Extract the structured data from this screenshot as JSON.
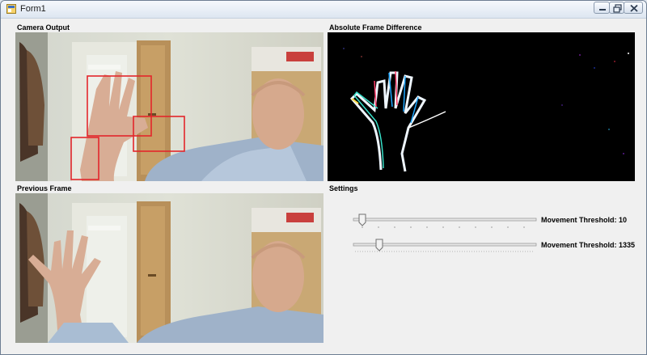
{
  "window": {
    "title": "Form1",
    "icon": "winforms-app-icon",
    "buttons": {
      "minimize": "minimize-icon",
      "maximize": "restore-icon",
      "close": "close-icon"
    }
  },
  "panels": {
    "camera_output": {
      "label": "Camera Output"
    },
    "frame_difference": {
      "label": "Absolute Frame Difference"
    },
    "previous_frame": {
      "label": "Previous Frame"
    },
    "settings": {
      "label": "Settings"
    }
  },
  "settings": {
    "trackbars": [
      {
        "label": "Movement Threshold: 10",
        "value": 10
      },
      {
        "label": "Movement Threshold: 1335",
        "value": 1335
      }
    ]
  },
  "colors": {
    "detection_box": "#ff0000",
    "diff_background": "#000000",
    "window_background": "#f0f0f0"
  }
}
